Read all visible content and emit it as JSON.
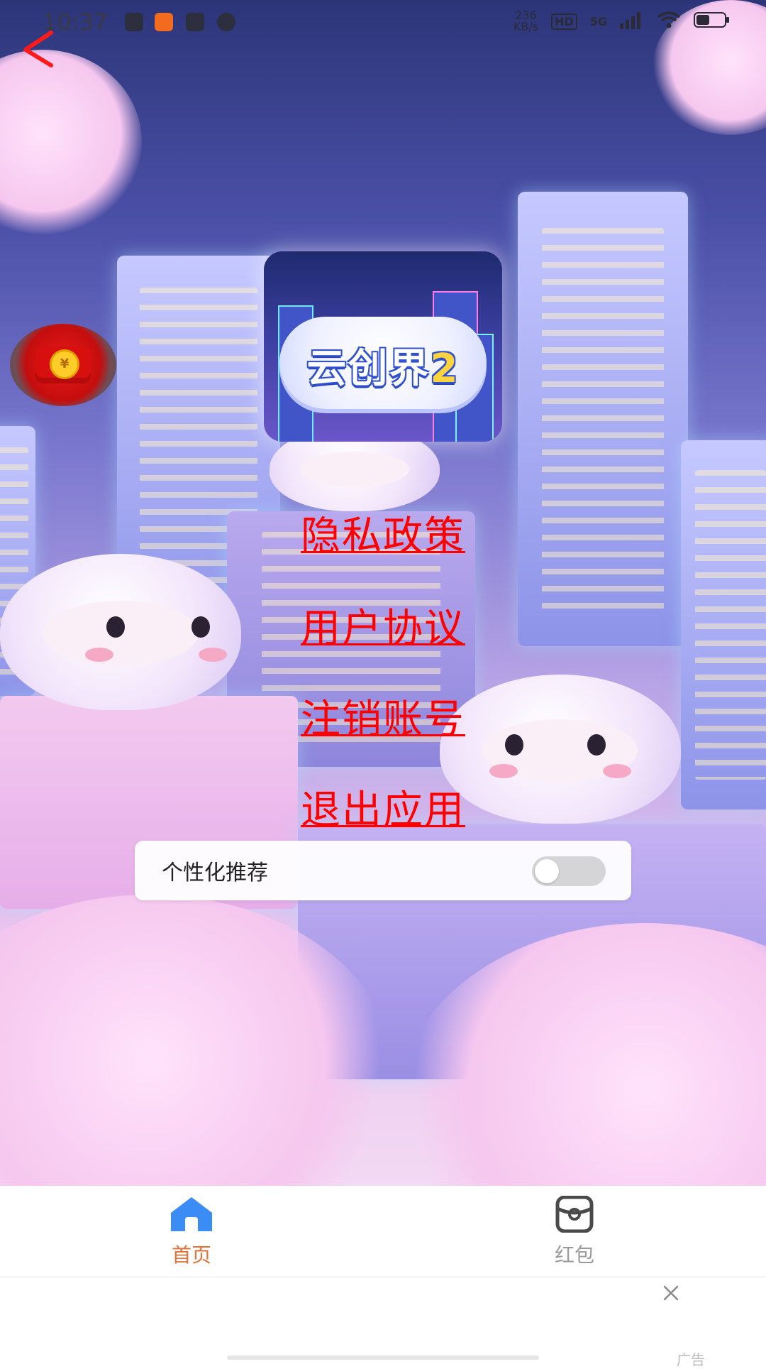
{
  "status_bar": {
    "time": "10:37",
    "network_speed_value": "236",
    "network_speed_unit": "KB/s",
    "hd_badge": "HD",
    "network_type": "5G"
  },
  "app": {
    "logo_title_text": "云创界",
    "logo_title_number": "2"
  },
  "menu": {
    "privacy_policy": "隐私政策",
    "user_agreement": "用户协议",
    "delete_account": "注销账号",
    "exit_app": "退出应用"
  },
  "settings": {
    "personalized_recommendation_label": "个性化推荐",
    "personalized_recommendation_enabled": false
  },
  "tabbar": {
    "home_label": "首页",
    "red_packet_label": "红包",
    "active_tab": "home"
  },
  "ad": {
    "label": "广告"
  },
  "colors": {
    "menu_link": "#ff0000",
    "active_tab": "#e2713a",
    "inactive_tab": "#9a9a9a",
    "home_icon": "#3b8cf5"
  },
  "icons": [
    "back-arrow-icon",
    "red-packet-icon",
    "home-icon",
    "red-packet-tab-icon",
    "close-icon",
    "wifi-icon",
    "signal-icon",
    "battery-icon"
  ]
}
